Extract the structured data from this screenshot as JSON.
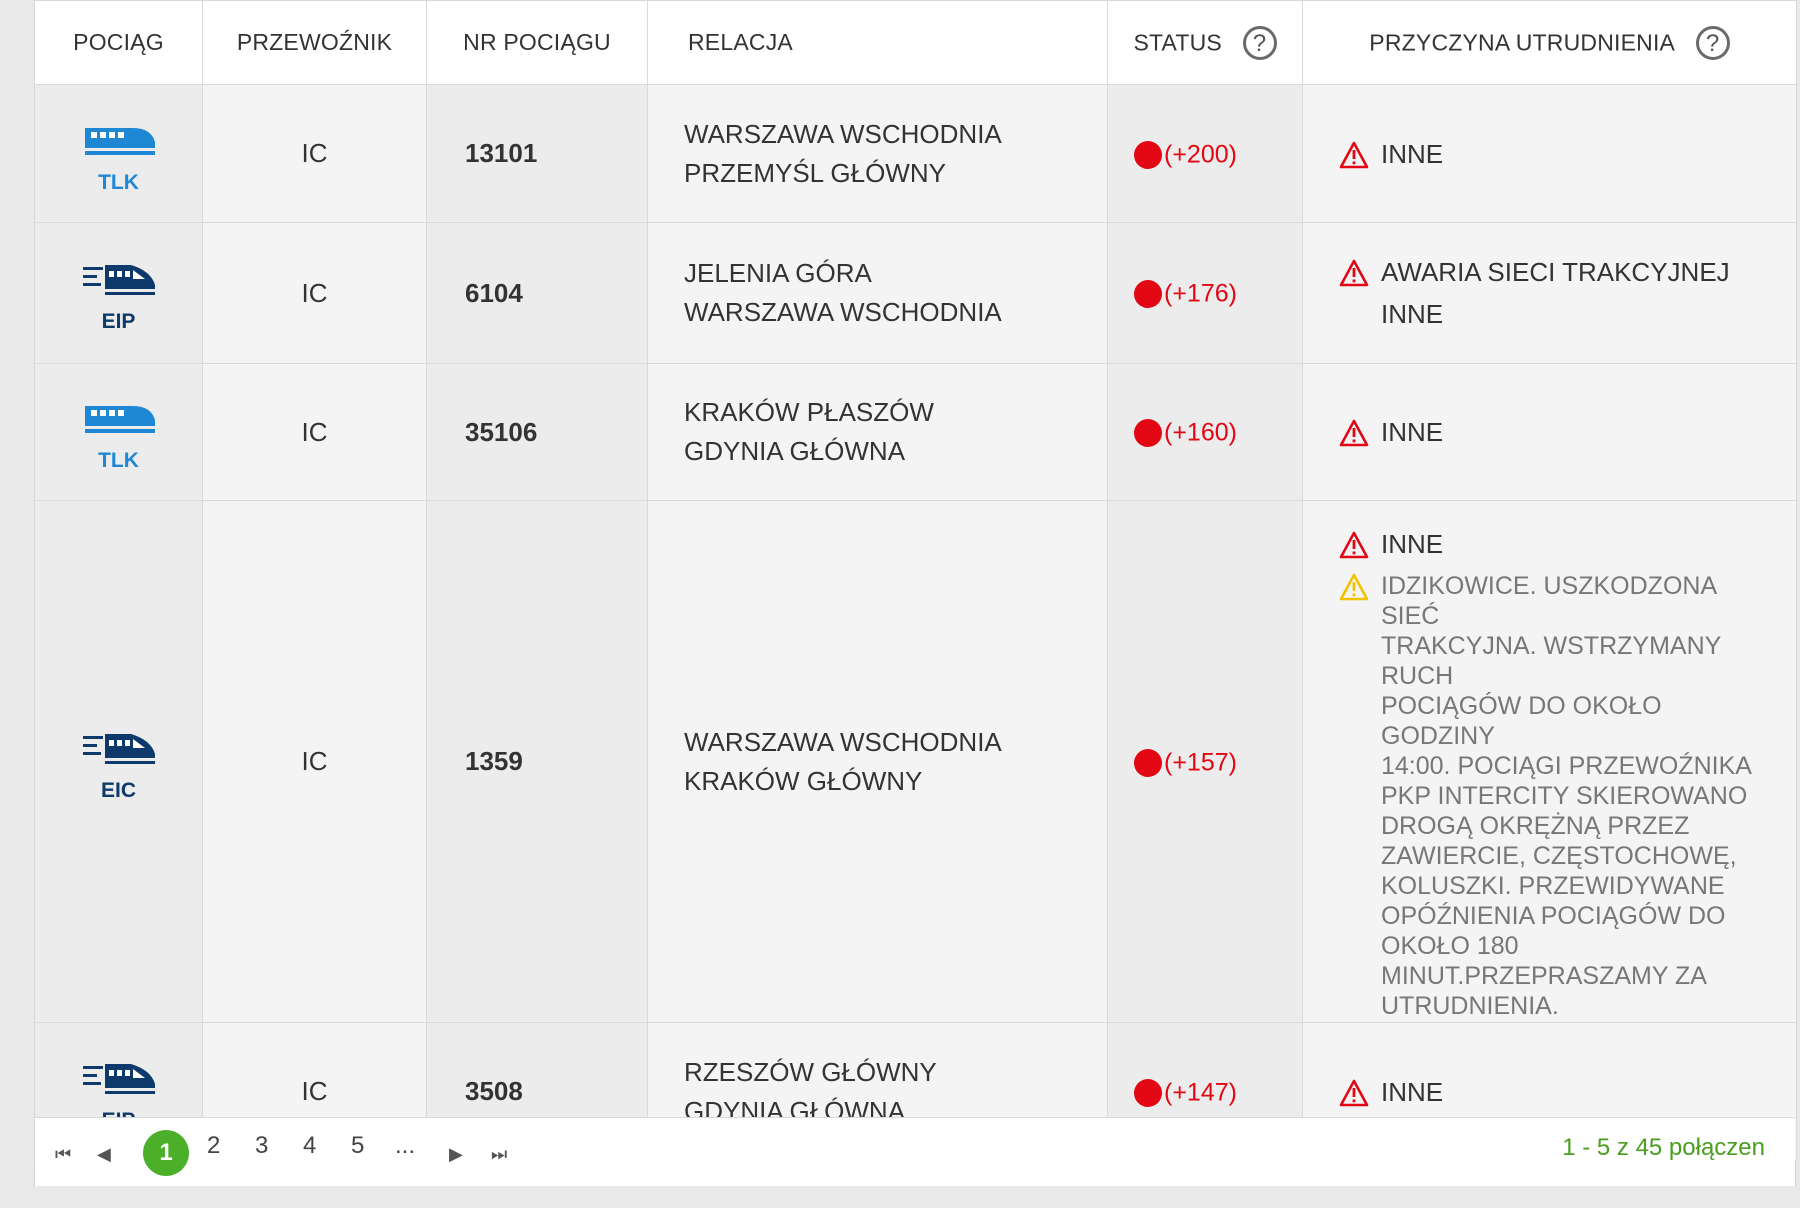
{
  "columns": {
    "train": "POCIĄG",
    "carrier": "PRZEWOŹNIK",
    "number": "NR POCIĄGU",
    "route": "RELACJA",
    "status": "STATUS",
    "reason": "PRZYCZYNA UTRUDNIENIA"
  },
  "help_glyph": "?",
  "colors": {
    "delay_red": "#e30613",
    "tlk_blue": "#1e88d4",
    "eip_navy": "#0d3a6b",
    "pager_green": "#4caf2a",
    "warning_red": "#e30613",
    "warning_yellow": "#f2c200"
  },
  "rows": [
    {
      "type": "TLK",
      "icon": "train-tlk-icon",
      "carrier": "IC",
      "number": "13101",
      "from": "WARSZAWA WSCHODNIA",
      "to": "PRZEMYŚL GŁÓWNY",
      "delay": "(+200)",
      "reasons": [
        "INNE"
      ]
    },
    {
      "type": "EIP",
      "icon": "train-eip-icon",
      "carrier": "IC",
      "number": "6104",
      "from": "JELENIA GÓRA",
      "to": "WARSZAWA WSCHODNIA",
      "delay": "(+176)",
      "reasons": [
        "AWARIA SIECI TRAKCYJNEJ",
        "INNE"
      ]
    },
    {
      "type": "TLK",
      "icon": "train-tlk-icon",
      "carrier": "IC",
      "number": "35106",
      "from": "KRAKÓW PŁASZÓW",
      "to": "GDYNIA GŁÓWNA",
      "delay": "(+160)",
      "reasons": [
        "INNE"
      ]
    },
    {
      "type": "EIC",
      "icon": "train-eic-icon",
      "carrier": "IC",
      "number": "1359",
      "from": "WARSZAWA WSCHODNIA",
      "to": "KRAKÓW GŁÓWNY",
      "delay": "(+157)",
      "reasons": [
        "INNE"
      ],
      "note_lines": [
        "IDZIKOWICE. USZKODZONA SIEĆ",
        "TRAKCYJNA. WSTRZYMANY RUCH",
        "POCIĄGÓW DO OKOŁO GODZINY",
        "14:00. POCIĄGI PRZEWOŹNIKA",
        "PKP INTERCITY SKIEROWANO",
        "DROGĄ OKRĘŻNĄ PRZEZ",
        "ZAWIERCIE, CZĘSTOCHOWĘ,",
        "KOLUSZKI. PRZEWIDYWANE",
        "OPÓŹNIENIA POCIĄGÓW DO",
        "OKOŁO 180",
        "MINUT.PRZEPRASZAMY ZA",
        "UTRUDNIENIA."
      ]
    },
    {
      "type": "EIP",
      "icon": "train-eip-icon",
      "carrier": "IC",
      "number": "3508",
      "from": "RZESZÓW GŁÓWNY",
      "to": "GDYNIA GŁÓWNA",
      "delay": "(+147)",
      "reasons": [
        "INNE"
      ]
    }
  ],
  "pagination": {
    "current": "1",
    "pages": [
      "2",
      "3",
      "4",
      "5"
    ],
    "ellipsis": "...",
    "summary": "1 - 5 z 45 połączen"
  }
}
